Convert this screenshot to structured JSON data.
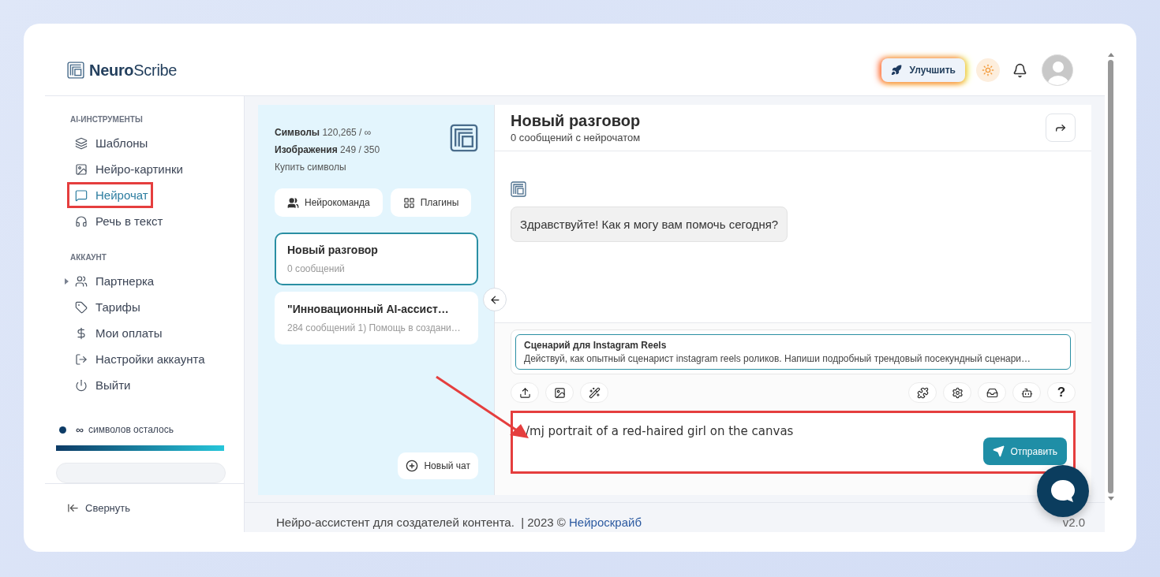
{
  "brand": {
    "bold": "Neuro",
    "light": "Scribe"
  },
  "header": {
    "upgrade_button": "Улучшить"
  },
  "sidebar": {
    "sections": [
      {
        "title": "AI-ИНСТРУМЕНТЫ",
        "items": [
          {
            "label": "Шаблоны",
            "selected": false,
            "highlighted": false,
            "has_submenu": false
          },
          {
            "label": "Нейро-картинки",
            "selected": false,
            "highlighted": false,
            "has_submenu": false
          },
          {
            "label": "Нейрочат",
            "selected": true,
            "highlighted": true,
            "has_submenu": false
          },
          {
            "label": "Речь в текст",
            "selected": false,
            "highlighted": false,
            "has_submenu": false
          }
        ]
      },
      {
        "title": "АККАУНТ",
        "items": [
          {
            "label": "Партнерка",
            "selected": false,
            "highlighted": false,
            "has_submenu": true
          },
          {
            "label": "Тарифы",
            "selected": false,
            "highlighted": false,
            "has_submenu": false
          },
          {
            "label": "Мои оплаты",
            "selected": false,
            "highlighted": false,
            "has_submenu": false
          },
          {
            "label": "Настройки аккаунта",
            "selected": false,
            "highlighted": false,
            "has_submenu": false
          },
          {
            "label": "Выйти",
            "selected": false,
            "highlighted": false,
            "has_submenu": false
          }
        ]
      }
    ],
    "quota": {
      "symbol": "∞",
      "label": "символов осталось",
      "color": "#0d3b66",
      "level": 1.0
    },
    "collapse": "Свернуть"
  },
  "chat_list": {
    "stats": [
      {
        "label": "Символы",
        "value": "120,265 / ∞"
      },
      {
        "label": "Изображения",
        "value": "249 / 350"
      }
    ],
    "buy_link": "Купить символы",
    "buttons": [
      {
        "label": "Нейрокоманда"
      },
      {
        "label": "Плагины"
      }
    ],
    "conversations": [
      {
        "title": "Новый разговор",
        "subtitle": "0 сообщений",
        "selected": true
      },
      {
        "title": "\"Инновационный AI-ассист…",
        "subtitle": "284 сообщений 1) Помощь в создани…",
        "selected": false
      }
    ],
    "new_chat": "Новый чат"
  },
  "chat": {
    "title": "Новый разговор",
    "subtitle": "0 сообщений с нейрочатом",
    "messages": [
      {
        "text": "Здравствуйте! Как я могу вам помочь сегодня?"
      }
    ],
    "template": {
      "title": "Сценарий для Instagram Reels",
      "text": "Действуй, как опытный сценарист instagram reels роликов. Напиши подробный трендовый посекундный сценари…"
    },
    "tools_left": [
      {
        "kind": "icon"
      },
      {
        "kind": "icon"
      },
      {
        "kind": "icon"
      }
    ],
    "tools_right": [
      {
        "kind": "icon"
      },
      {
        "kind": "icon"
      },
      {
        "kind": "icon"
      },
      {
        "kind": "icon"
      },
      {
        "kind": "text",
        "text": "?"
      }
    ],
    "input": {
      "value": "/mj portrait of a red-haired girl on the canvas",
      "highlighted": true
    },
    "send_button": "Отправить"
  },
  "footer": {
    "text": "Нейро-ассистент для создателей контента.  | 2023 © ",
    "link": "Нейроскрайб",
    "version": "v2.0"
  }
}
